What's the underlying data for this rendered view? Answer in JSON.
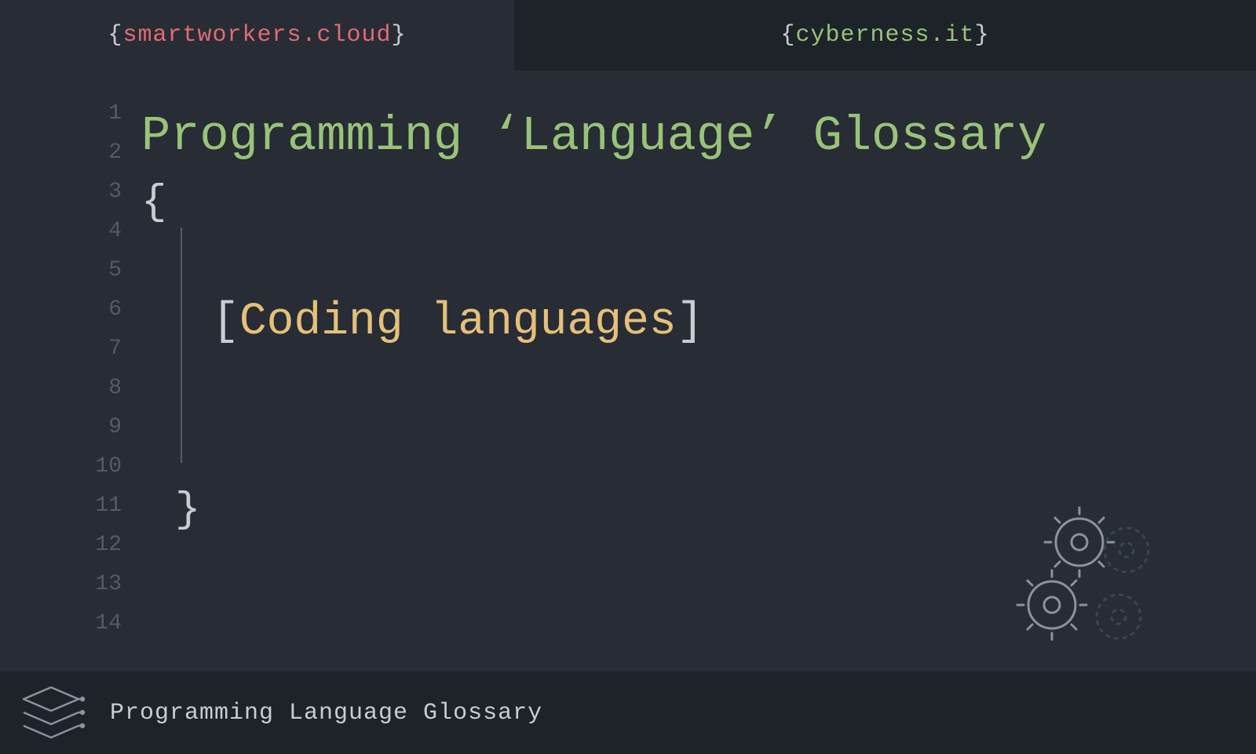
{
  "tabs": {
    "left": "smartworkers.cloud",
    "right": "cyberness.it"
  },
  "editor": {
    "line_numbers": [
      "1",
      "2",
      "3",
      "4",
      "5",
      "6",
      "7",
      "8",
      "9",
      "10",
      "11",
      "12",
      "13",
      "14"
    ],
    "title": "Programming ‘Language’ Glossary",
    "open_brace": "{",
    "close_brace": "}",
    "subtitle": "Coding languages",
    "bracket_open": "[",
    "bracket_close": "]"
  },
  "footer": {
    "title": "Programming Language Glossary"
  },
  "colors": {
    "background": "#282c34",
    "background_dark": "#1e2229",
    "green": "#98c379",
    "red": "#e06c75",
    "yellow": "#e5c07b",
    "muted": "#545b68",
    "foreground": "#c9cdd3"
  }
}
